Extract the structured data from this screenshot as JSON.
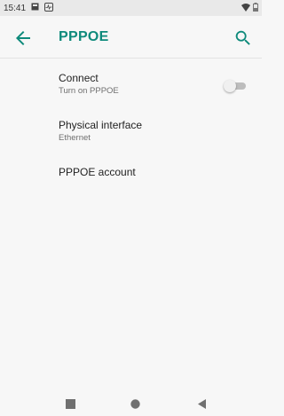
{
  "status_bar": {
    "time": "15:41",
    "icons": [
      "notification-box-icon",
      "activity-icon",
      "wifi-icon",
      "battery-icon"
    ]
  },
  "app_bar": {
    "title": "PPPOE",
    "accent_color": "#0e8a7b",
    "back_icon": "arrow-back-icon",
    "search_icon": "search-icon"
  },
  "preferences": [
    {
      "title": "Connect",
      "summary": "Turn on PPPOE",
      "toggle_on": false
    },
    {
      "title": "Physical interface",
      "summary": "Ethernet"
    },
    {
      "title": "PPPOE account"
    }
  ],
  "nav_bar": {
    "icons": [
      "recents-square-icon",
      "home-circle-icon",
      "back-triangle-icon"
    ]
  }
}
